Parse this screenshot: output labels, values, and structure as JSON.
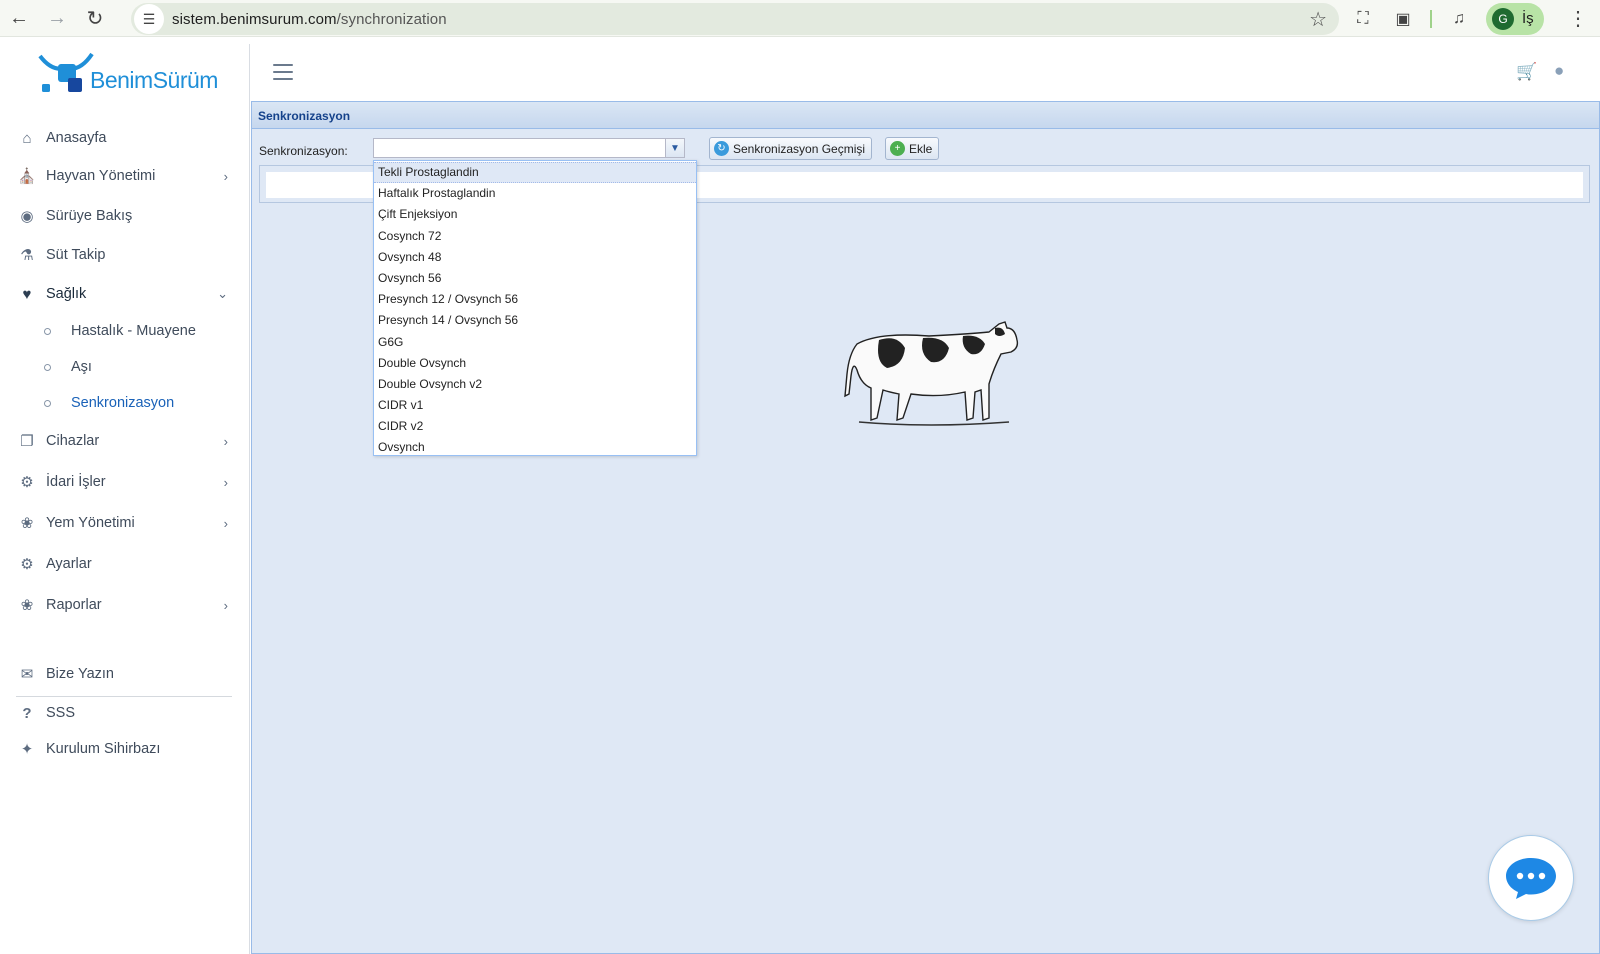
{
  "browser": {
    "url_host": "sistem.benimsurum.com",
    "url_path": "/synchronization",
    "profile_initial": "G",
    "profile_label": "İş"
  },
  "app": {
    "logo_text": "BenimSürüm"
  },
  "sidebar": {
    "items": [
      {
        "label": "Anasayfa",
        "icon": "home-icon"
      },
      {
        "label": "Hayvan Yönetimi",
        "icon": "barn-icon"
      },
      {
        "label": "Sürüye Bakış",
        "icon": "cow-head-icon"
      },
      {
        "label": "Süt Takip",
        "icon": "flask-icon"
      },
      {
        "label": "Sağlık",
        "icon": "hand-heart-icon"
      },
      {
        "label": "Cihazlar",
        "icon": "devices-icon"
      },
      {
        "label": "İdari İşler",
        "icon": "user-gear-icon"
      },
      {
        "label": "Yem Yönetimi",
        "icon": "wheat-icon"
      },
      {
        "label": "Ayarlar",
        "icon": "gear-icon"
      },
      {
        "label": "Raporlar",
        "icon": "wheat-icon"
      },
      {
        "label": "Bize Yazın",
        "icon": "contact-icon"
      },
      {
        "label": "SSS",
        "icon": "question-icon"
      },
      {
        "label": "Kurulum Sihirbazı",
        "icon": "magic-wand-icon"
      }
    ],
    "health_sub": [
      {
        "label": "Hastalık - Muayene"
      },
      {
        "label": "Aşı"
      },
      {
        "label": "Senkronizasyon"
      }
    ]
  },
  "panel": {
    "title": "Senkronizasyon",
    "field_label": "Senkronizasyon:",
    "combo_value": "",
    "history_button": "Senkronizasyon Geçmişi",
    "add_button": "Ekle"
  },
  "dropdown": {
    "options": [
      "Tekli Prostaglandin",
      "Haftalık Prostaglandin",
      "Çift Enjeksiyon",
      "Cosynch 72",
      "Ovsynch 48",
      "Ovsynch 56",
      "Presynch 12 / Ovsynch 56",
      "Presynch 14 / Ovsynch 56",
      "G6G",
      "Double Ovsynch",
      "Double Ovsynch v2",
      "CIDR v1",
      "CIDR v2",
      "Ovsynch"
    ],
    "highlighted": "Tekli Prostaglandin"
  },
  "colors": {
    "panel_bg": "#dfe8f5",
    "panel_title": "#15428b",
    "brand": "#1f8fd8",
    "active_sub": "#1a62b8"
  }
}
